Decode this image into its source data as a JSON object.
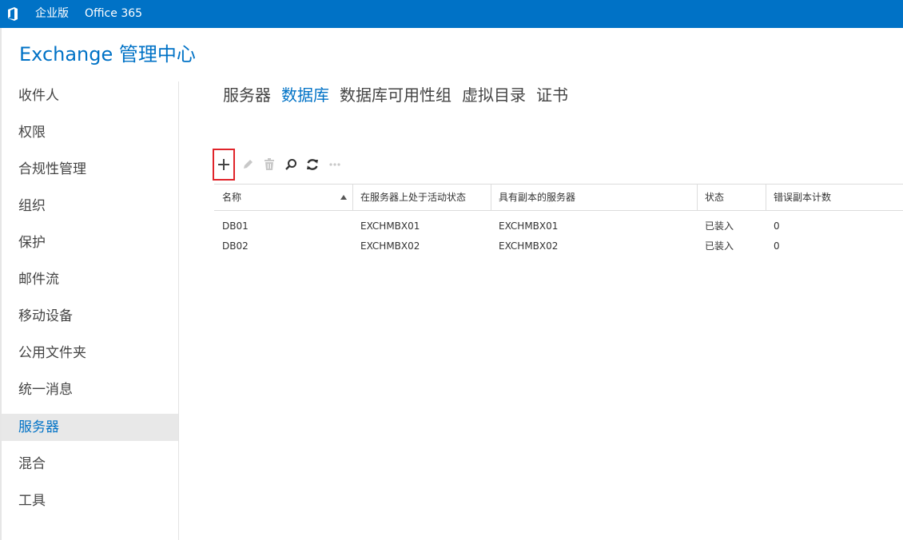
{
  "topbar": {
    "logo_icon": "office-logo-icon",
    "edition": "企业版",
    "suite": "Office 365",
    "color": "#0072c6"
  },
  "app": {
    "title": "Exchange 管理中心"
  },
  "nav": {
    "items": [
      {
        "label": "收件人"
      },
      {
        "label": "权限"
      },
      {
        "label": "合规性管理"
      },
      {
        "label": "组织"
      },
      {
        "label": "保护"
      },
      {
        "label": "邮件流"
      },
      {
        "label": "移动设备"
      },
      {
        "label": "公用文件夹"
      },
      {
        "label": "统一消息"
      },
      {
        "label": "服务器",
        "selected": true
      },
      {
        "label": "混合"
      },
      {
        "label": "工具"
      }
    ]
  },
  "tabs": [
    {
      "label": "服务器"
    },
    {
      "label": "数据库",
      "active": true
    },
    {
      "label": "数据库可用性组"
    },
    {
      "label": "虚拟目录"
    },
    {
      "label": "证书"
    }
  ],
  "toolbar": {
    "buttons": [
      {
        "icon": "add-icon",
        "enabled": true,
        "highlighted": true
      },
      {
        "icon": "edit-icon",
        "enabled": false
      },
      {
        "icon": "delete-icon",
        "enabled": false
      },
      {
        "icon": "search-icon",
        "enabled": true
      },
      {
        "icon": "refresh-icon",
        "enabled": true
      },
      {
        "icon": "more-icon",
        "enabled": false
      }
    ],
    "highlight_color": "#e0242a"
  },
  "grid": {
    "columns": [
      "名称",
      "在服务器上处于活动状态",
      "具有副本的服务器",
      "状态",
      "错误副本计数"
    ],
    "sort": {
      "column": "名称",
      "direction": "ascending"
    },
    "rows": [
      [
        "DB01",
        "EXCHMBX01",
        "EXCHMBX01",
        "已装入",
        "0"
      ],
      [
        "DB02",
        "EXCHMBX02",
        "EXCHMBX02",
        "已装入",
        "0"
      ]
    ]
  }
}
